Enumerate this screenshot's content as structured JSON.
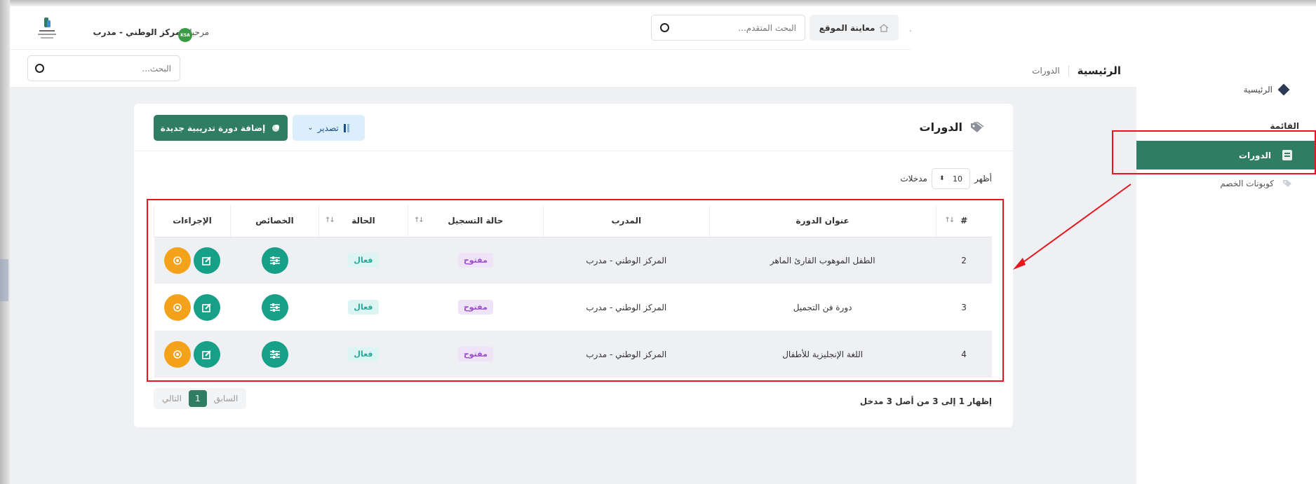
{
  "header": {
    "welcome_prefix": "مرحبا",
    "welcome_name": "المركز الوطني - مدرب",
    "flag_label": "KSA",
    "advanced_search_placeholder": "البحث المتقدم...",
    "view_site_label": "معاينة الموقع"
  },
  "subheader": {
    "search_placeholder": "البحث...",
    "breadcrumb_home": "الرئيسية",
    "breadcrumb_current": "الدورات"
  },
  "sidebar": {
    "home_label": "الرئيسية",
    "section_label": "القائمة",
    "items": [
      {
        "label": "الدورات",
        "active": true
      },
      {
        "label": "كوبونات الخصم",
        "active": false
      }
    ]
  },
  "card": {
    "title": "الدورات",
    "add_button_label": "إضافة دورة تدريبية جديدة",
    "export_button_label": "تصدير",
    "show_label": "أظهر",
    "page_length": "10",
    "entries_label": "مدخلات"
  },
  "table": {
    "headers": [
      "#",
      "عنوان الدورة",
      "المدرب",
      "حالة التسجيل",
      "الحالة",
      "الخصائص",
      "الإجراءات"
    ],
    "rows": [
      {
        "id": "2",
        "title": "الطفل الموهوب القارئ الماهر",
        "trainer": "المركز الوطني - مدرب",
        "registration": "مفتوح",
        "status": "فعال"
      },
      {
        "id": "3",
        "title": "دورة فن التجميل",
        "trainer": "المركز الوطني - مدرب",
        "registration": "مفتوح",
        "status": "فعال"
      },
      {
        "id": "4",
        "title": "اللغة الإنجليزية للأطفال",
        "trainer": "المركز الوطني - مدرب",
        "registration": "مفتوح",
        "status": "فعال"
      }
    ]
  },
  "footer": {
    "info": "إظهار 1 إلى 3 من أصل 3 مدخل",
    "prev_label": "السابق",
    "current_page": "1",
    "next_label": "التالي"
  },
  "colors": {
    "primary": "#2f7d62",
    "annotation_red": "#e8151c",
    "badge_open": "#9b4dc9",
    "badge_active": "#27a89a",
    "action_teal": "#17a088",
    "action_orange": "#f5a21b"
  },
  "icons": {
    "logo": "org-logo-icon",
    "search": "search-icon",
    "home": "home-icon",
    "tag": "tag-icon",
    "export": "export-icon",
    "add": "add-icon",
    "edit": "edit-icon",
    "view": "view-icon",
    "settings": "sliders-icon"
  }
}
